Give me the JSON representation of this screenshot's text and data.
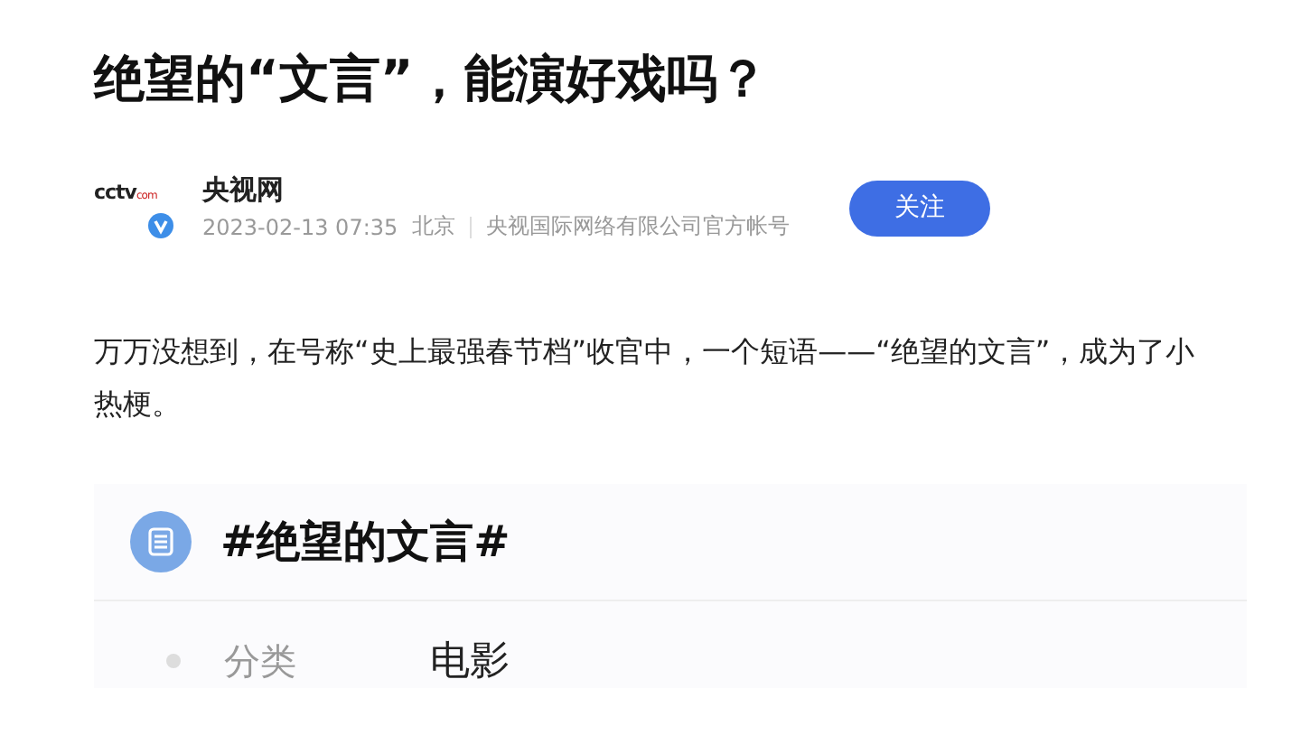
{
  "article": {
    "title": "绝望的“文言”，能演好戏吗？",
    "author": {
      "logo_text": "cctv",
      "logo_suffix": "com",
      "verified": true,
      "name": "央视网",
      "date": "2023-02-13 07:35",
      "location": "北京",
      "description": "央视国际网络有限公司官方帐号"
    },
    "follow_button": "关注",
    "paragraph": "万万没想到，在号称“史上最强春节档”收官中，一个短语——“绝望的文言”，成为了小热梗。",
    "topic": {
      "title": "#绝望的文言#"
    },
    "details": [
      {
        "label": "分类",
        "value": "电影"
      }
    ]
  }
}
